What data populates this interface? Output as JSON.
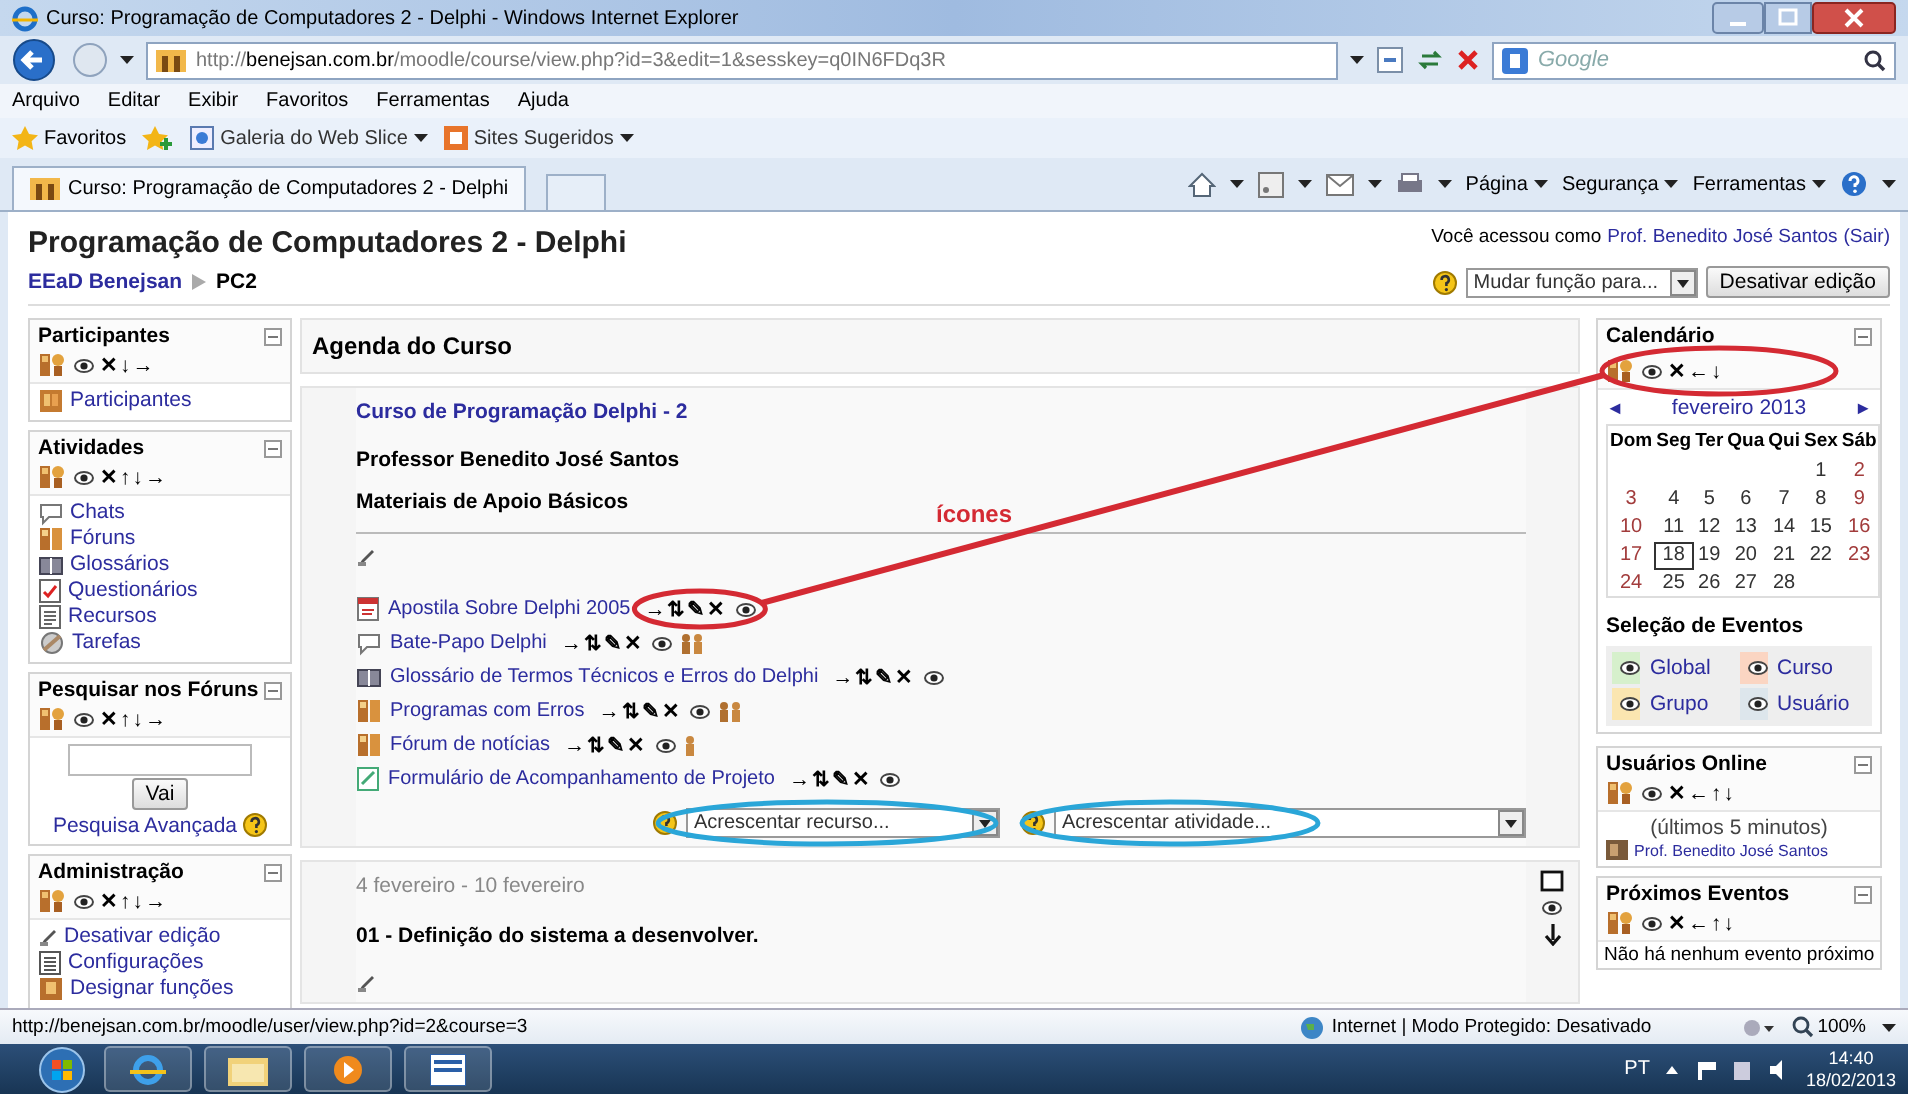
{
  "window": {
    "title": "Curso: Programação de Computadores 2 - Delphi - Windows Internet Explorer"
  },
  "address_bar": {
    "url": "http://**benejsan.com.br**/moodle/course/view.php?id=3&edit=1&sesskey=q0IN6FDq3R"
  },
  "search_box": {
    "placeholder": "Google"
  },
  "menu": [
    "Arquivo",
    "Editar",
    "Exibir",
    "Favoritos",
    "Ferramentas",
    "Ajuda"
  ],
  "favorites_bar": {
    "label": "Favoritos",
    "links": [
      "Galeria do Web Slice",
      "Sites Sugeridos"
    ]
  },
  "tabs": [
    {
      "title": "Curso: Programação de Computadores 2 - Delphi",
      "selected": true
    }
  ],
  "command_bar": [
    "Página",
    "Segurança",
    "Ferramentas"
  ],
  "page": {
    "heading": "Programação de Computadores 2 - Delphi",
    "login_prefix": "Você acessou como",
    "login_user": "Prof. Benedito José Santos",
    "logout": "(Sair)",
    "breadcrumb": [
      "EEaD Benejsan",
      "PC2"
    ],
    "role_select": "Mudar função para...",
    "edit_button": "Desativar edição"
  },
  "left_blocks": [
    {
      "kind": "links",
      "title": "Participantes",
      "controls": "✕↓→",
      "items": [
        {
          "kind": "participants",
          "label": "Participantes"
        }
      ]
    },
    {
      "kind": "links",
      "title": "Atividades",
      "controls": "✕↑↓→",
      "items": [
        {
          "kind": "chat",
          "label": "Chats"
        },
        {
          "kind": "forum",
          "label": "Fóruns"
        },
        {
          "kind": "glossary",
          "label": "Glossários"
        },
        {
          "kind": "quiz",
          "label": "Questionários"
        },
        {
          "kind": "resource",
          "label": "Recursos"
        },
        {
          "kind": "assignment",
          "label": "Tarefas"
        }
      ]
    },
    {
      "kind": "search",
      "title": "Pesquisar nos Fóruns",
      "controls": "✕↑↓→",
      "button": "Vai",
      "advanced": "Pesquisa Avançada"
    },
    {
      "kind": "links",
      "title": "Administração",
      "controls": "✕↑↓→",
      "items": [
        {
          "kind": "editing",
          "label": "Desativar edição"
        },
        {
          "kind": "settings",
          "label": "Configurações"
        },
        {
          "kind": "roles",
          "label": "Designar funções"
        }
      ]
    }
  ],
  "center": {
    "title": "Agenda do Curso",
    "sections": [
      {
        "kind": "intro",
        "course_link": "Curso de Programação Delphi - 2",
        "lines": [
          "Professor Benedito José Santos",
          "Materiais de Apoio Básicos"
        ],
        "activities": [
          {
            "kind": "pdf",
            "label": "Apostila Sobre Delphi 2005",
            "controls": "→⇅✎✕"
          },
          {
            "kind": "chat",
            "label": "Bate-Papo Delphi",
            "controls": "→⇅✎✕"
          },
          {
            "kind": "glossary",
            "label": "Glossário de Termos Técnicos e Erros do Delphi",
            "controls": "→⇅✎✕"
          },
          {
            "kind": "forum",
            "label": "Programas com Erros",
            "controls": "→⇅✎✕"
          },
          {
            "kind": "news_forum",
            "label": "Fórum de notícias",
            "controls": "→⇅✎✕"
          },
          {
            "kind": "form",
            "label": "Formulário de Acompanhamento de Projeto",
            "controls": "→⇅✎✕"
          }
        ],
        "add_resource": "Acrescentar recurso...",
        "add_activity": "Acrescentar atividade..."
      },
      {
        "kind": "week",
        "dates": "4 fevereiro - 10 fevereiro",
        "title": "01 - Definição do sistema a desenvolver."
      }
    ]
  },
  "calendar": {
    "title": "Calendário",
    "controls": "✕←↓",
    "prev": "◄",
    "month": "fevereiro 2013",
    "next": "►",
    "weekdays": [
      "Dom",
      "Seg",
      "Ter",
      "Qua",
      "Qui",
      "Sex",
      "Sáb"
    ],
    "weeks": [
      [
        {
          "day": "1",
          "today": false
        },
        {
          "day": "2",
          "today": false
        }
      ],
      [
        {
          "day": "3",
          "today": false
        },
        {
          "day": "4",
          "today": false
        },
        {
          "day": "5",
          "today": false
        },
        {
          "day": "6",
          "today": false
        },
        {
          "day": "7",
          "today": false
        },
        {
          "day": "8",
          "today": false
        },
        {
          "day": "9",
          "today": false
        }
      ],
      [
        {
          "day": "10",
          "today": false
        },
        {
          "day": "11",
          "today": false
        },
        {
          "day": "12",
          "today": false
        },
        {
          "day": "13",
          "today": false
        },
        {
          "day": "14",
          "today": false
        },
        {
          "day": "15",
          "today": false
        },
        {
          "day": "16",
          "today": false
        }
      ],
      [
        {
          "day": "17",
          "today": false
        },
        {
          "day": "18",
          "today": true
        },
        {
          "day": "19",
          "today": false
        },
        {
          "day": "20",
          "today": false
        },
        {
          "day": "21",
          "today": false
        },
        {
          "day": "22",
          "today": false
        },
        {
          "day": "23",
          "today": false
        }
      ],
      [
        {
          "day": "24",
          "today": false
        },
        {
          "day": "25",
          "today": false
        },
        {
          "day": "26",
          "today": false
        },
        {
          "day": "27",
          "today": false
        },
        {
          "day": "28",
          "today": false
        }
      ]
    ],
    "events_title": "Seleção de Eventos",
    "events": [
      {
        "label": "Global",
        "color": "#d6f0cc"
      },
      {
        "label": "Curso",
        "color": "#fbd5c2"
      },
      {
        "label": "Grupo",
        "color": "#fbe6b0"
      },
      {
        "label": "Usuário",
        "color": "#dde6ec"
      }
    ]
  },
  "online": {
    "title": "Usuários Online",
    "controls": "✕←↑↓",
    "note": "(últimos 5 minutos)",
    "users": [
      "Prof. Benedito José Santos"
    ]
  },
  "upcoming": {
    "title": "Próximos Eventos",
    "controls": "✕←↑↓",
    "message": "Não há nenhum evento próximo"
  },
  "status_bar": {
    "url": "http://benejsan.com.br/moodle/user/view.php?id=2&course=3",
    "zone": "Internet | Modo Protegido: Desativado",
    "zoom": "100%"
  },
  "taskbar": {
    "language": "PT",
    "time": "14:40",
    "date": "18/02/2013"
  },
  "annotations": [
    {
      "kind": "ellipse",
      "color": "#d42a33"
    },
    {
      "kind": "ellipse",
      "color": "#d42a33"
    },
    {
      "kind": "line",
      "color": "#d42a33"
    },
    {
      "kind": "label",
      "text": "ícones",
      "color": "#d42a33"
    },
    {
      "kind": "ellipse",
      "color": "#2aa6d8"
    },
    {
      "kind": "ellipse",
      "color": "#2aa6d8"
    }
  ]
}
